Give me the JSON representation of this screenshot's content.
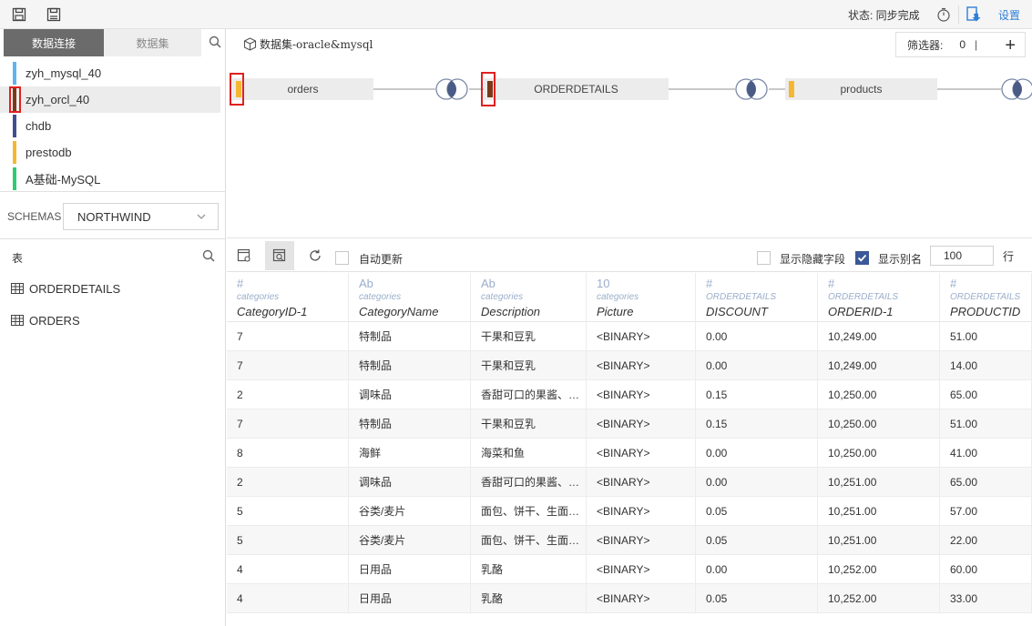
{
  "topbar": {
    "status": "状态: 同步完成",
    "settings": "设置",
    "icons": [
      "save-icon",
      "save-as-icon",
      "history-icon",
      "sync-download-icon"
    ]
  },
  "left": {
    "tabs": [
      "数据连接",
      "数据集"
    ],
    "connections": [
      {
        "name": "zyh_mysql_40",
        "color": "#5fb4f0",
        "selected": false
      },
      {
        "name": "zyh_orcl_40",
        "color": "#7a3a1a",
        "selected": true
      },
      {
        "name": "chdb",
        "color": "#3f4f8f",
        "selected": false
      },
      {
        "name": "prestodb",
        "color": "#f5b731",
        "selected": false
      },
      {
        "name": "A基础-MySQL",
        "color": "#2ecc71",
        "selected": false
      }
    ],
    "schema_label": "SCHEMAS",
    "schema_value": "NORTHWIND",
    "tables_header": "表",
    "tables": [
      "ORDERDETAILS",
      "ORDERS"
    ]
  },
  "canvas": {
    "dataset_title": "数据集-oracle&mysql",
    "filter_label": "筛选器:",
    "filter_count": "0",
    "filter_sep": "|",
    "nodes": [
      {
        "name": "orders",
        "color": "#f5b731"
      },
      {
        "name": "ORDERDETAILS",
        "color": "#7a3a1a"
      },
      {
        "name": "products",
        "color": "#f5b731"
      }
    ]
  },
  "toolbar2": {
    "auto_update": "自动更新",
    "show_hidden": "显示隐藏字段",
    "show_alias": "显示别名",
    "rows_value": "100",
    "rows_unit": "行"
  },
  "grid": {
    "columns": [
      {
        "type": "#",
        "source": "categories",
        "name": "CategoryID-1"
      },
      {
        "type": "Ab",
        "source": "categories",
        "name": "CategoryName"
      },
      {
        "type": "Ab",
        "source": "categories",
        "name": "Description"
      },
      {
        "type": "10",
        "source": "categories",
        "name": "Picture"
      },
      {
        "type": "#",
        "source": "ORDERDETAILS",
        "name": "DISCOUNT"
      },
      {
        "type": "#",
        "source": "ORDERDETAILS",
        "name": "ORDERID-1"
      },
      {
        "type": "#",
        "source": "ORDERDETAILS",
        "name": "PRODUCTID"
      }
    ],
    "rows": [
      [
        "7",
        "特制品",
        "干果和豆乳",
        "<BINARY>",
        "0.00",
        "10,249.00",
        "51.00"
      ],
      [
        "7",
        "特制品",
        "干果和豆乳",
        "<BINARY>",
        "0.00",
        "10,249.00",
        "14.00"
      ],
      [
        "2",
        "调味品",
        "香甜可口的果酱、…",
        "<BINARY>",
        "0.15",
        "10,250.00",
        "65.00"
      ],
      [
        "7",
        "特制品",
        "干果和豆乳",
        "<BINARY>",
        "0.15",
        "10,250.00",
        "51.00"
      ],
      [
        "8",
        "海鲜",
        "海菜和鱼",
        "<BINARY>",
        "0.00",
        "10,250.00",
        "41.00"
      ],
      [
        "2",
        "调味品",
        "香甜可口的果酱、…",
        "<BINARY>",
        "0.00",
        "10,251.00",
        "65.00"
      ],
      [
        "5",
        "谷类/麦片",
        "面包、饼干、生面…",
        "<BINARY>",
        "0.05",
        "10,251.00",
        "57.00"
      ],
      [
        "5",
        "谷类/麦片",
        "面包、饼干、生面…",
        "<BINARY>",
        "0.05",
        "10,251.00",
        "22.00"
      ],
      [
        "4",
        "日用品",
        "乳酪",
        "<BINARY>",
        "0.00",
        "10,252.00",
        "60.00"
      ],
      [
        "4",
        "日用品",
        "乳酪",
        "<BINARY>",
        "0.05",
        "10,252.00",
        "33.00"
      ]
    ]
  }
}
